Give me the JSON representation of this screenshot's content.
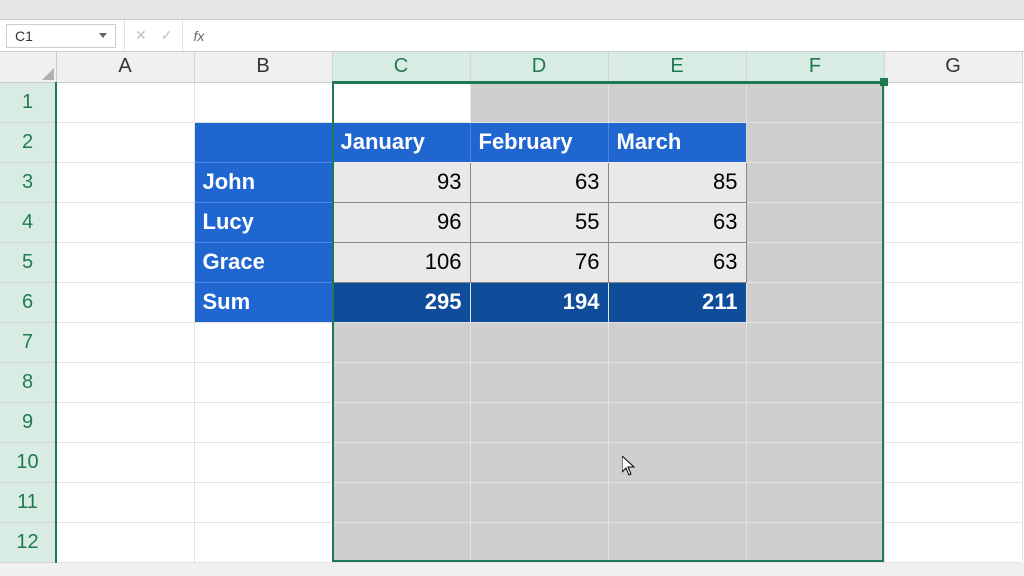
{
  "name_box": "C1",
  "fx_label": "fx",
  "formula_value": "",
  "columns": [
    "A",
    "B",
    "C",
    "D",
    "E",
    "F",
    "G"
  ],
  "selected_cols": [
    "C",
    "D",
    "E",
    "F"
  ],
  "rows": [
    "1",
    "2",
    "3",
    "4",
    "5",
    "6",
    "7",
    "8",
    "9",
    "10",
    "11",
    "12"
  ],
  "selected_rows": [
    "1",
    "2",
    "3",
    "4",
    "5",
    "6",
    "7",
    "8",
    "9",
    "10",
    "11",
    "12"
  ],
  "active_cell": "C1",
  "table": {
    "months": {
      "jan": "January",
      "feb": "February",
      "mar": "March"
    },
    "people": {
      "john": {
        "label": "John",
        "jan": "93",
        "feb": "63",
        "mar": "85"
      },
      "lucy": {
        "label": "Lucy",
        "jan": "96",
        "feb": "55",
        "mar": "63"
      },
      "grace": {
        "label": "Grace",
        "jan": "106",
        "feb": "76",
        "mar": "63"
      }
    },
    "sum": {
      "label": "Sum",
      "jan": "295",
      "feb": "194",
      "mar": "211"
    }
  },
  "chart_data": {
    "type": "table",
    "columns": [
      "",
      "January",
      "February",
      "March"
    ],
    "rows": [
      [
        "John",
        93,
        63,
        85
      ],
      [
        "Lucy",
        96,
        55,
        63
      ],
      [
        "Grace",
        106,
        76,
        63
      ],
      [
        "Sum",
        295,
        194,
        211
      ]
    ]
  }
}
